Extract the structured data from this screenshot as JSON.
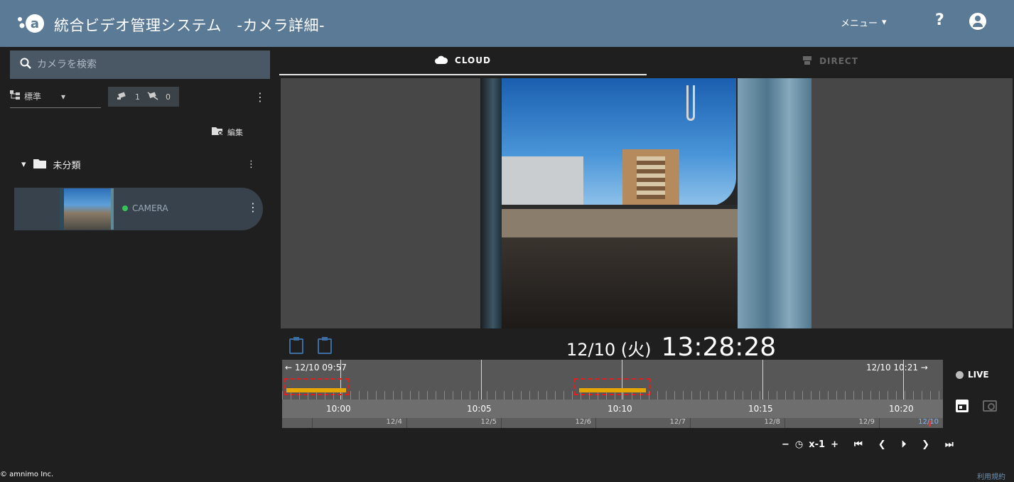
{
  "header": {
    "title": "統合ビデオ管理システム　-カメラ詳細-",
    "menu_label": "メニュー",
    "help_label": "?",
    "logo_text": "a"
  },
  "sidebar": {
    "search_placeholder": "カメラを検索",
    "view_label": "標準",
    "online_count": "1",
    "offline_count": "0",
    "edit_label": "編集",
    "folder_name": "未分類",
    "camera_name": "CAMERA"
  },
  "tabs": [
    {
      "label": "CLOUD",
      "icon": "cloud-icon",
      "active": true
    },
    {
      "label": "DIRECT",
      "icon": "direct-camera-icon",
      "active": false
    }
  ],
  "playback": {
    "date": "12/10 (火)",
    "time": "13:28:28",
    "range_start": "← 12/10 09:57",
    "range_end": "12/10 10:21 →",
    "time_ticks": [
      "10:00",
      "10:05",
      "10:10",
      "10:15",
      "10:20"
    ],
    "day_ticks": [
      "12/4",
      "12/5",
      "12/6",
      "12/7",
      "12/8",
      "12/9",
      "12/10"
    ],
    "live_label": "LIVE",
    "speed_minus": "−",
    "speed_label": "x-1",
    "speed_plus": "+",
    "colors": {
      "recording": "#e6a800",
      "highlight": "#e02020",
      "live": "#bbbbbb"
    }
  },
  "footer": {
    "copyright": "© amnimo Inc.",
    "terms": "利用規約"
  }
}
